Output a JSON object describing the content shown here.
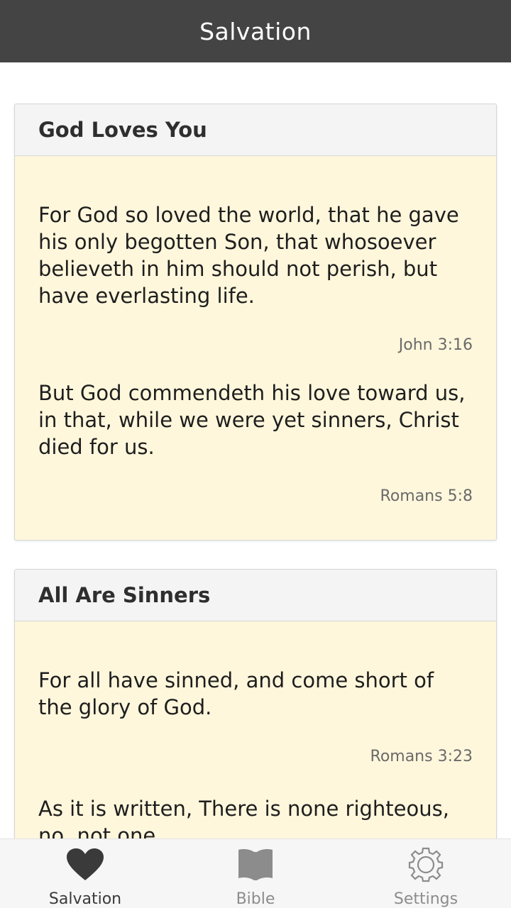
{
  "header": {
    "title": "Salvation"
  },
  "sections": [
    {
      "title": "God Loves You",
      "verses": [
        {
          "text": "For God so loved the world, that he gave his only begotten Son, that whosoever believeth in him should not perish, but have everlasting life.",
          "reference": "John 3:16"
        },
        {
          "text": "But God commendeth his love toward us, in that, while we were yet sinners, Christ died for us.",
          "reference": "Romans 5:8"
        }
      ]
    },
    {
      "title": "All Are Sinners",
      "verses": [
        {
          "text": "For all have sinned, and come short of the glory of God.",
          "reference": "Romans 3:23"
        },
        {
          "text": "As it is written, There is none righteous, no, not one"
        }
      ]
    }
  ],
  "tabbar": {
    "tabs": [
      {
        "label": "Salvation",
        "icon": "heart-icon",
        "active": true
      },
      {
        "label": "Bible",
        "icon": "book-icon",
        "active": false
      },
      {
        "label": "Settings",
        "icon": "gear-icon",
        "active": false
      }
    ]
  },
  "colors": {
    "header_bg": "#444444",
    "card_header_bg": "#f4f4f4",
    "card_body_bg": "#fff7dc",
    "active_icon": "#3a3a3a",
    "inactive_icon": "#8c8c8c"
  }
}
